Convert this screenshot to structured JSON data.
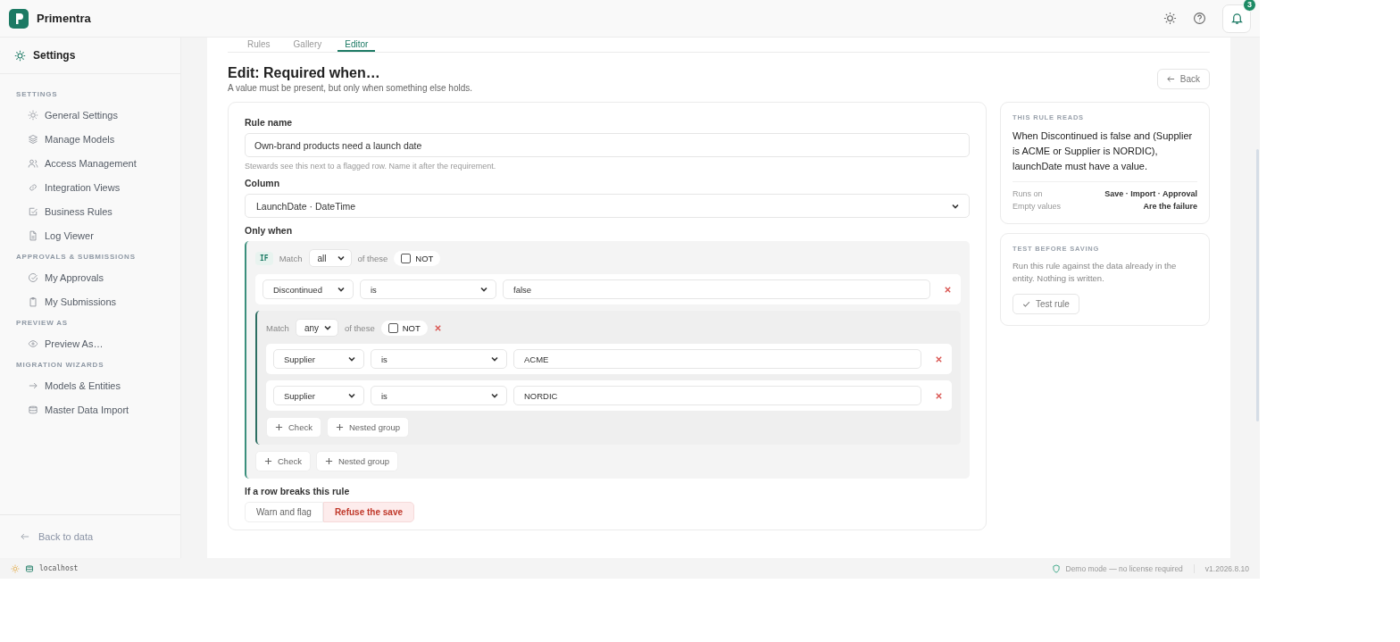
{
  "app": {
    "name": "Primentra",
    "notification_count": "3"
  },
  "sidebar": {
    "title": "Settings",
    "sections": [
      {
        "heading": "SETTINGS",
        "items": [
          "General Settings",
          "Manage Models",
          "Access Management",
          "Integration Views",
          "Business Rules",
          "Log Viewer"
        ]
      },
      {
        "heading": "APPROVALS & SUBMISSIONS",
        "items": [
          "My Approvals",
          "My Submissions"
        ]
      },
      {
        "heading": "PREVIEW AS",
        "items": [
          "Preview As…"
        ]
      },
      {
        "heading": "MIGRATION WIZARDS",
        "items": [
          "Models & Entities",
          "Master Data Import"
        ]
      }
    ],
    "footer": "Back to data"
  },
  "tabs": [
    {
      "label": "Rules",
      "selected": false
    },
    {
      "label": "Gallery",
      "selected": false
    },
    {
      "label": "Editor",
      "selected": true
    }
  ],
  "page": {
    "title": "Edit: Required when…",
    "subtitle": "A value must be present, but only when something else holds.",
    "back": "Back"
  },
  "form": {
    "rule_name_label": "Rule name",
    "rule_name_value": "Own-brand products need a launch date",
    "rule_name_hint": "Stewards see this next to a flagged row. Name it after the requirement.",
    "column_label": "Column",
    "column_value": "LaunchDate · DateTime",
    "only_when_label": "Only when",
    "conditions": {
      "badge": "IF",
      "match": "Match",
      "quantifier": "all",
      "suffix": "of these",
      "not": {
        "label": "NOT",
        "checked": false
      },
      "add_check": "Check",
      "add_group": "Nested group",
      "items": [
        {
          "kind": "check",
          "field": "Discontinued",
          "operator": "is",
          "value": "false"
        },
        {
          "kind": "group",
          "match": "Match",
          "quantifier": "any",
          "suffix": "of these",
          "not": {
            "label": "NOT",
            "checked": false
          },
          "add_check": "Check",
          "add_group": "Nested group",
          "items": [
            {
              "kind": "check",
              "field": "Supplier",
              "operator": "is",
              "value": "ACME"
            },
            {
              "kind": "check",
              "field": "Supplier",
              "operator": "is",
              "value": "NORDIC"
            }
          ]
        }
      ]
    },
    "breaks_label": "If a row breaks this rule",
    "actions": [
      {
        "label": "Warn and flag",
        "selected": false
      },
      {
        "label": "Refuse the save",
        "selected": true
      }
    ]
  },
  "summary": {
    "heading": "THIS RULE READS",
    "text": "When Discontinued is false and (Supplier is ACME or Supplier is NORDIC), launchDate must have a value.",
    "rows": [
      {
        "label": "Runs on",
        "value": "Save · Import · Approval"
      },
      {
        "label": "Empty values",
        "value": "Are the failure"
      }
    ]
  },
  "test": {
    "heading": "TEST BEFORE SAVING",
    "text": "Run this rule against the data already in the entity. Nothing is written.",
    "button": "Test rule"
  },
  "status_bar": {
    "host": "localhost",
    "mode": "Demo mode — no license required",
    "version": "v1.2026.8.10"
  }
}
